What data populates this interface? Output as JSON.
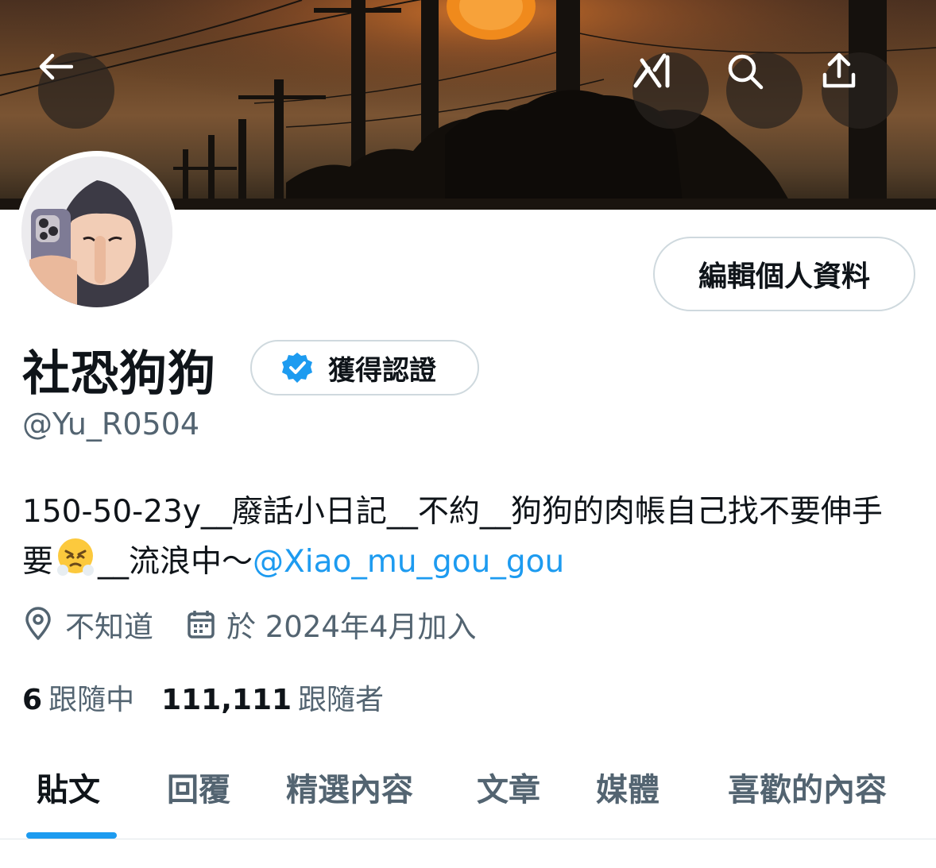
{
  "header": {
    "back_icon": "arrow-left-icon",
    "grok_icon": "grok-icon",
    "search_icon": "search-icon",
    "share_icon": "share-icon"
  },
  "profile": {
    "display_name": "社恐狗狗",
    "verification_label": "獲得認證",
    "handle": "@Yu_R0504",
    "edit_button_label": "編輯個人資料",
    "bio_text": "150-50-23y__廢話小日記__不約__狗狗的肉帳自己找不要伸手要",
    "bio_after_emoji": "__流浪中～",
    "bio_mention": "@Xiao_mu_gou_gou",
    "location": "不知道",
    "joined": "於 2024年4月加入",
    "following_count": "6",
    "following_label": "跟隨中",
    "followers_count": "111,111",
    "followers_label": "跟隨者"
  },
  "tabs": [
    {
      "label": "貼文",
      "active": true
    },
    {
      "label": "回覆",
      "active": false
    },
    {
      "label": "精選內容",
      "active": false
    },
    {
      "label": "文章",
      "active": false
    },
    {
      "label": "媒體",
      "active": false
    },
    {
      "label": "喜歡的內容",
      "active": false
    }
  ],
  "colors": {
    "accent": "#1d9bf0",
    "secondary_text": "#536471",
    "border": "#cfd9de"
  }
}
